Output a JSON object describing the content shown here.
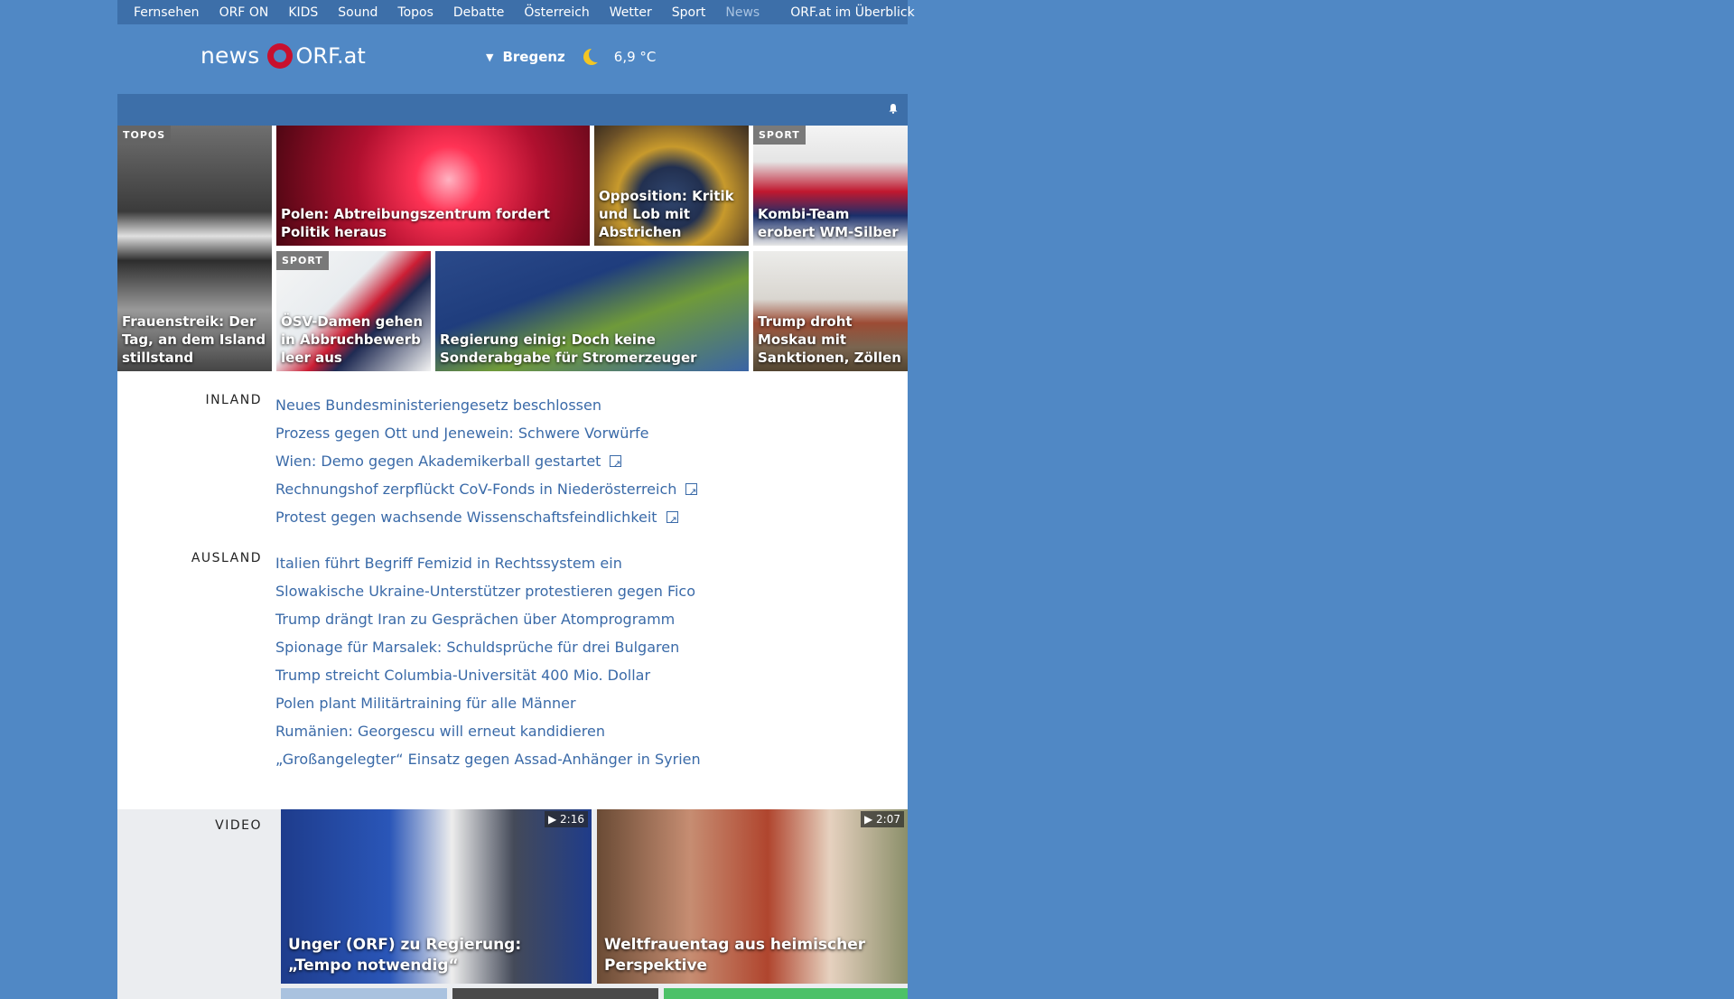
{
  "topnav": {
    "items": [
      "Fernsehen",
      "ORF ON",
      "KIDS",
      "Sound",
      "Topos",
      "Debatte",
      "Österreich",
      "Wetter",
      "Sport",
      "News"
    ],
    "overview": "ORF.at im Überblick"
  },
  "logo": {
    "news": "news",
    "orf": "ORF.at"
  },
  "weather": {
    "location": "Bregenz",
    "temperature": "6,9 °C",
    "icon": "moon-icon"
  },
  "tiles": [
    {
      "tag": "TOPOS",
      "caption": "Frauenstreik: Der Tag, an dem Island stillstand"
    },
    {
      "tag": "",
      "caption": "Polen: Abtreibungszentrum fordert Politik heraus"
    },
    {
      "tag": "",
      "caption": "Opposition: Kritik und Lob mit Abstrichen"
    },
    {
      "tag": "SPORT",
      "caption": "Kombi-Team erobert WM-Silber"
    },
    {
      "tag": "SPORT",
      "caption": "ÖSV-Damen gehen in Abbruchbewerb leer aus"
    },
    {
      "tag": "",
      "caption": "Regierung einig: Doch keine Sonderabgabe für Stromerzeuger"
    },
    {
      "tag": "",
      "caption": "Trump droht Moskau mit Sanktionen, Zöllen"
    }
  ],
  "inland": {
    "label": "INLAND",
    "items": [
      "Neues Bundesministeriengesetz beschlossen",
      "Prozess gegen Ott und Jenewein: Schwere Vorwürfe",
      "Wien: Demo gegen Akademikerball gestartet",
      "Rechnungshof zerpflückt CoV-Fonds in Niederösterreich",
      "Protest gegen wachsende Wissenschaftsfeindlichkeit"
    ]
  },
  "ausland": {
    "label": "AUSLAND",
    "items": [
      "Italien führt Begriff Femizid in Rechtssystem ein",
      "Slowakische Ukraine-Unterstützer protestieren gegen Fico",
      "Trump drängt Iran zu Gesprächen über Atomprogramm",
      "Spionage für Marsalek: Schuldsprüche für drei Bulgaren",
      "Trump streicht Columbia-Universität 400 Mio. Dollar",
      "Polen plant Militärtraining für alle Männer",
      "Rumänien: Georgescu will erneut kandidieren",
      "„Großangelegter“ Einsatz gegen Assad-Anhänger in Syrien"
    ]
  },
  "video": {
    "label": "VIDEO",
    "items": [
      {
        "duration": "▶ 2:16",
        "caption": "Unger (ORF) zu Regierung: „Tempo notwendig“"
      },
      {
        "duration": "▶ 2:07",
        "caption": "Weltfrauentag aus heimischer Perspektive"
      }
    ]
  },
  "colors": {
    "background": "#5088c5",
    "nav": "#3d6fa9",
    "link": "#3a6aa8",
    "brand_red": "#c8102e"
  }
}
